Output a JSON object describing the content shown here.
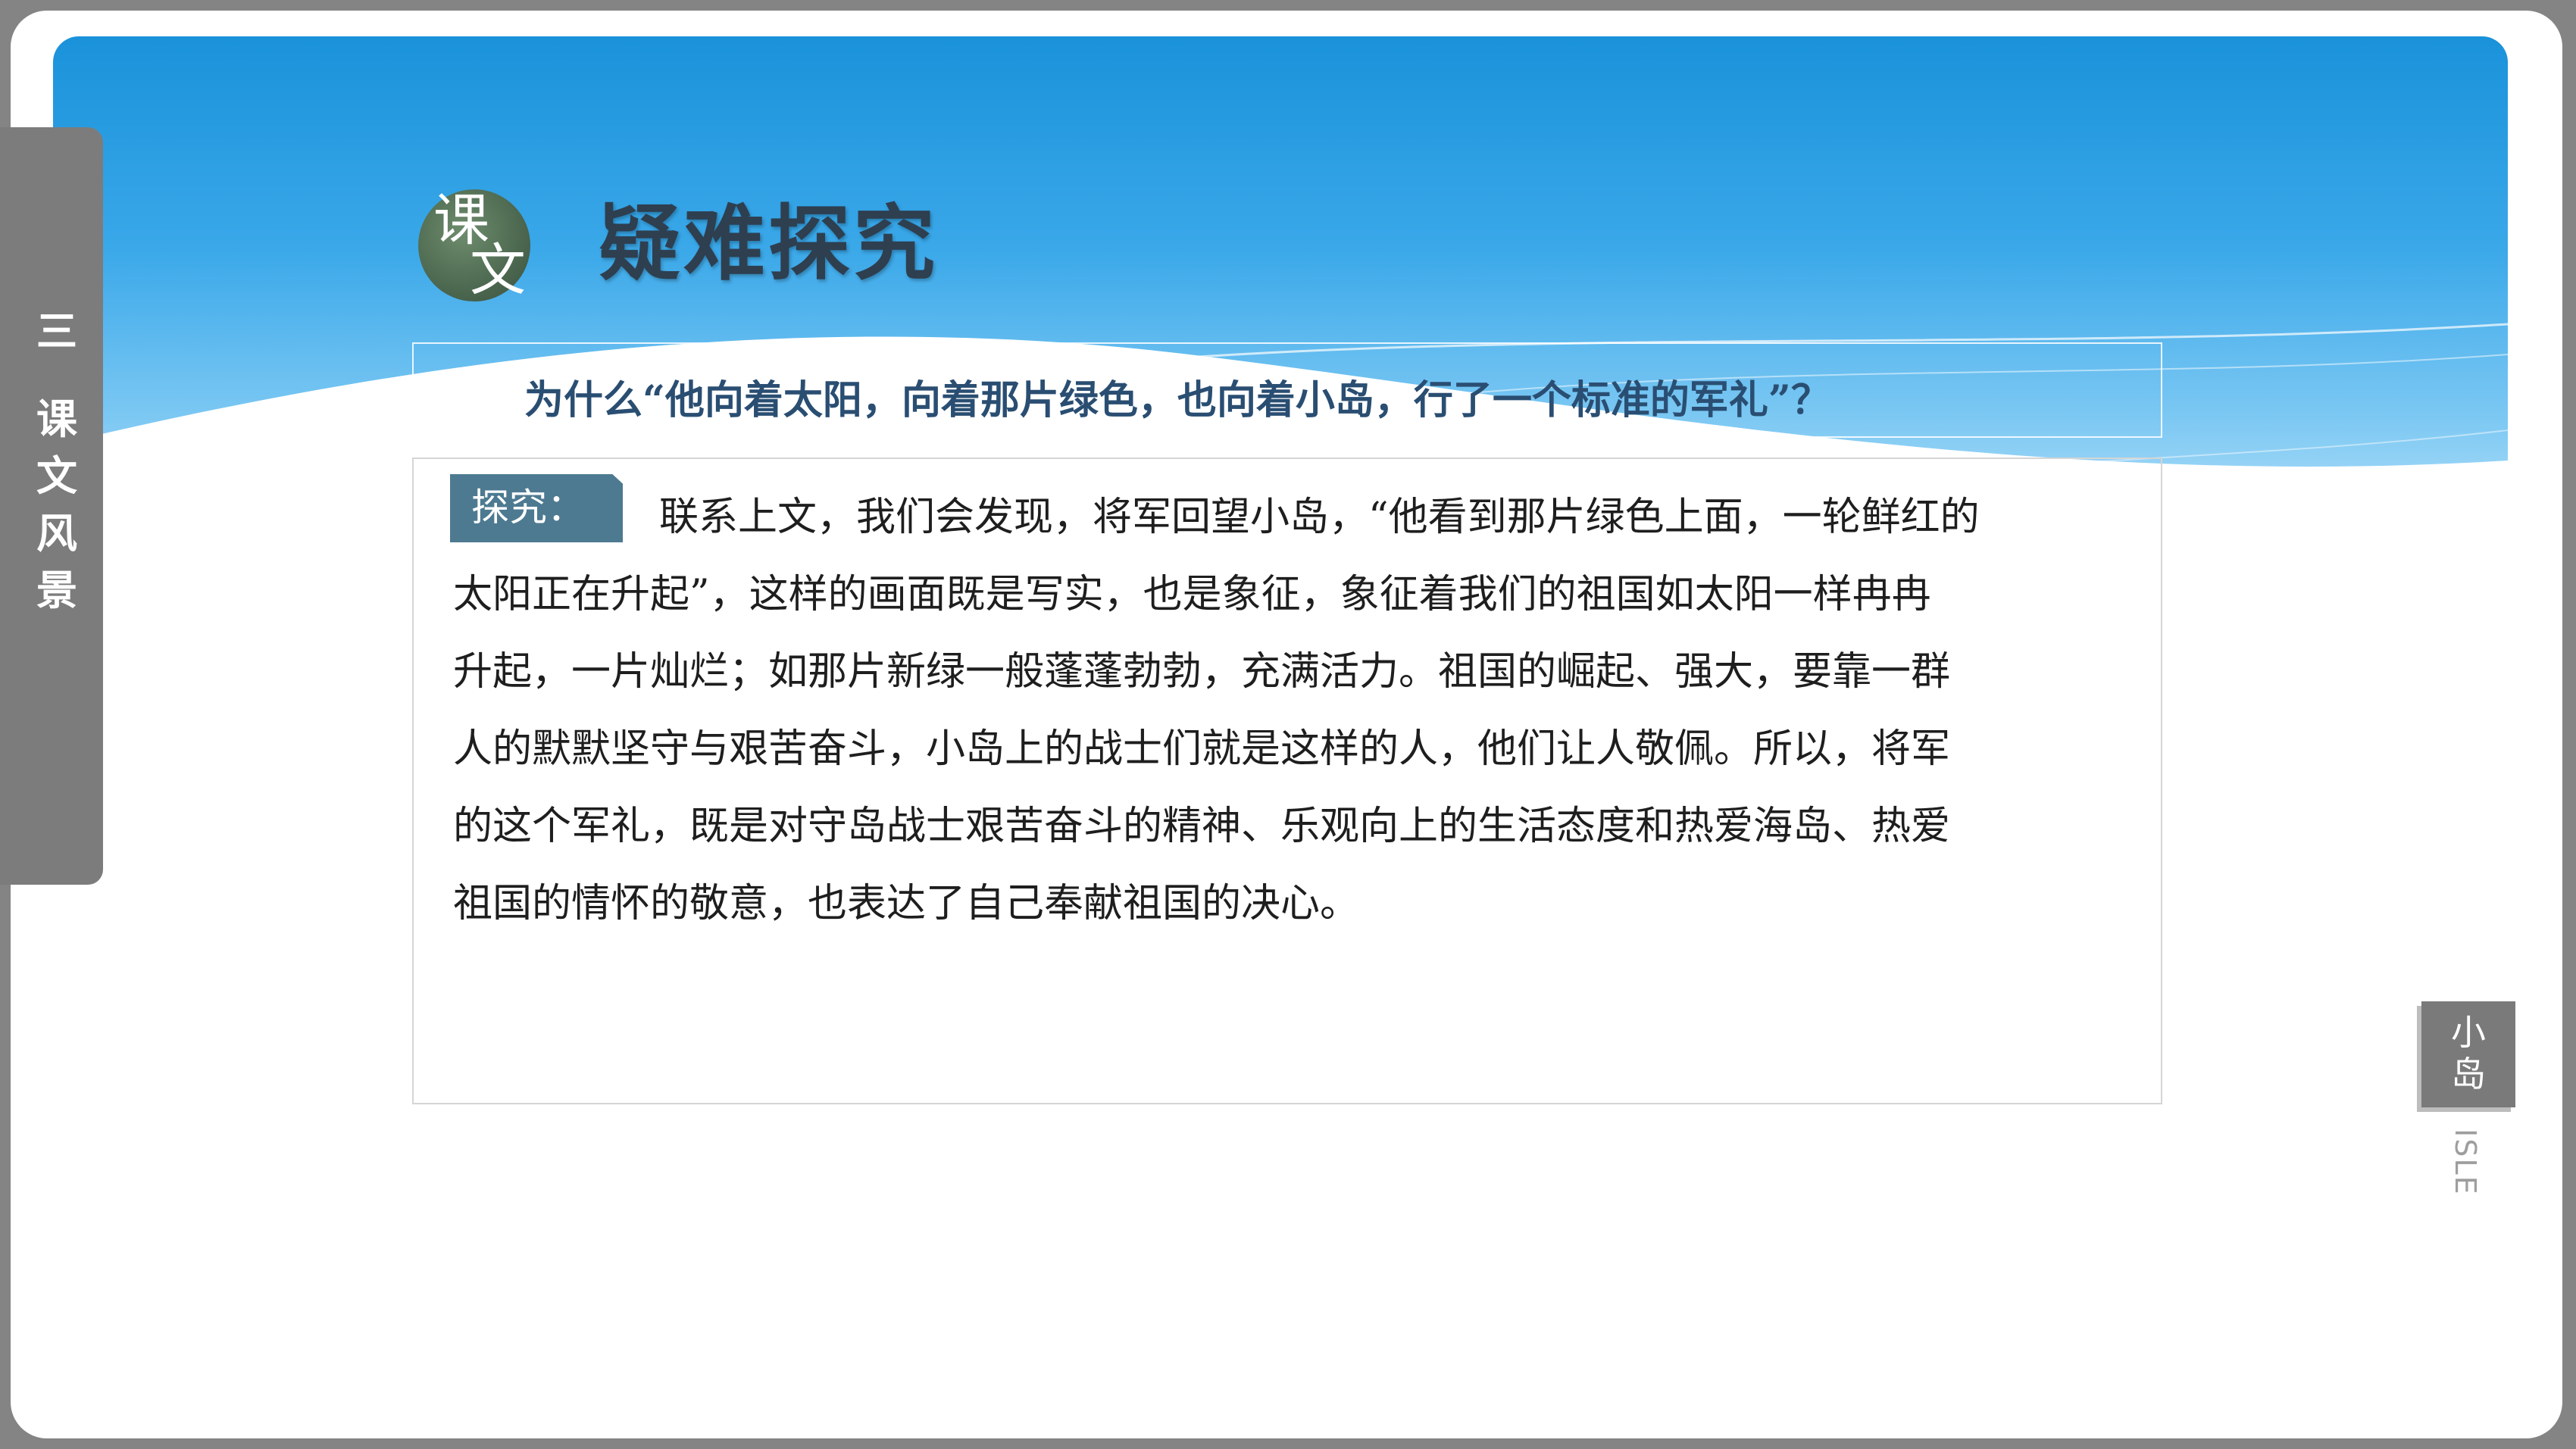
{
  "section": {
    "number": "三",
    "title": "课文风景",
    "chars": [
      "课",
      "文",
      "风",
      "景"
    ]
  },
  "badge": {
    "char1": "课",
    "char2": "文"
  },
  "heading": "疑难探究",
  "question": "为什么“他向着太阳，向着那片绿色，也向着小岛，行了一个标准的军礼”？",
  "explore": {
    "label": "探究：",
    "lines": [
      "联系上文，我们会发现，将军回望小岛，“他看到那片绿色上面，一轮鲜红的",
      "太阳正在升起”，这样的画面既是写实，也是象征，象征着我们的祖国如太阳一样冉冉",
      "升起，一片灿烂；如那片新绿一般蓬蓬勃勃，充满活力。祖国的崛起、强大，要靠一群",
      "人的默默坚守与艰苦奋斗，小岛上的战士们就是这样的人，他们让人敬佩。所以，将军",
      "的这个军礼，既是对守岛战士艰苦奋斗的精神、乐观向上的生活态度和热爱海岛、热爱",
      "祖国的情怀的敬意，也表达了自己奉献祖国的决心。"
    ]
  },
  "lesson": {
    "title_zh": "小岛",
    "title_en": "ISLE"
  },
  "colors": {
    "banner_top": "#1a92da",
    "banner_bottom": "#c7e8fb",
    "side_tab": "#7c7c7c",
    "heading": "#2e3f50",
    "question": "#2a4e72",
    "explore_tag": "#4d7a91",
    "badge": "#4f6b52"
  }
}
